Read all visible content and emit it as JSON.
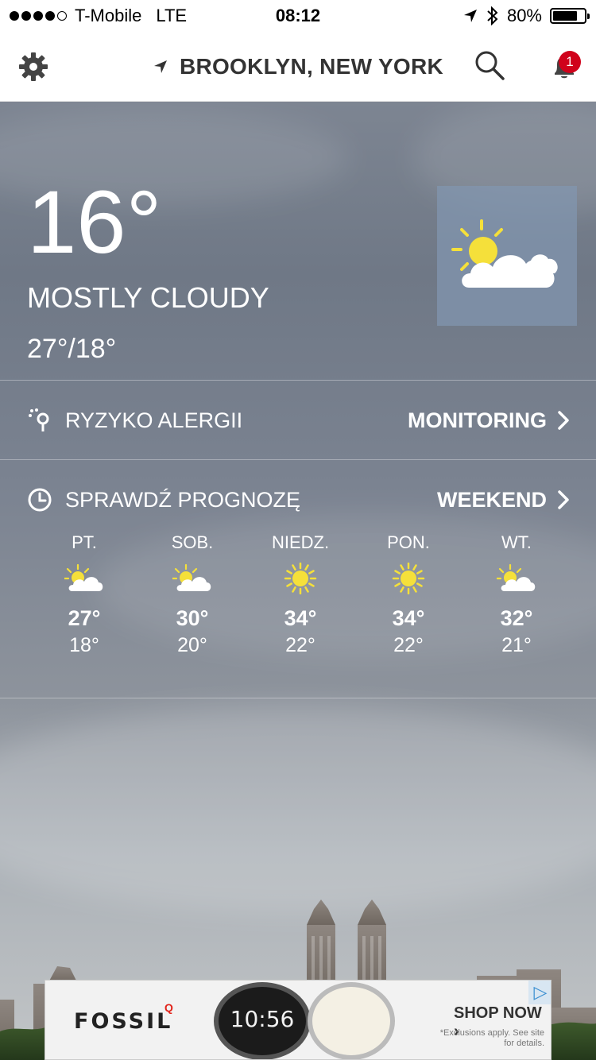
{
  "status_bar": {
    "carrier": "T-Mobile",
    "network": "LTE",
    "time": "08:12",
    "battery_percent": "80%",
    "battery_level": 0.8,
    "signal_bars_filled": 4,
    "signal_bars_total": 5
  },
  "header": {
    "location": "BROOKLYN, NEW YORK",
    "notification_count": "1",
    "icons": [
      "gear-icon",
      "location-arrow-icon",
      "search-icon",
      "bell-icon"
    ]
  },
  "current": {
    "temperature": "16°",
    "condition": "MOSTLY CLOUDY",
    "hi_lo": "27°/18°",
    "icon": "partly-cloudy-icon"
  },
  "allergy_row": {
    "label": "RYZYKO ALERGII",
    "action": "MONITORING",
    "icon": "allergy-icon"
  },
  "forecast_row": {
    "label": "SPRAWDŹ PROGNOZĘ",
    "action": "WEEKEND",
    "icon": "clock-icon"
  },
  "forecast": [
    {
      "day": "PT.",
      "high": "27°",
      "low": "18°",
      "icon": "partly-cloudy-icon"
    },
    {
      "day": "SOB.",
      "high": "30°",
      "low": "20°",
      "icon": "partly-cloudy-icon"
    },
    {
      "day": "NIEDZ.",
      "high": "34°",
      "low": "22°",
      "icon": "sunny-icon"
    },
    {
      "day": "PON.",
      "high": "34°",
      "low": "22°",
      "icon": "sunny-icon"
    },
    {
      "day": "WT.",
      "high": "32°",
      "low": "21°",
      "icon": "partly-cloudy-icon"
    }
  ],
  "ad": {
    "brand": "FOSSIL",
    "brand_mark": "Q",
    "watch_time": "10:56",
    "cta": "SHOP NOW ›",
    "disclaimer": "*Exclusions apply. See site for details.",
    "ad_choices_glyph": "▷"
  },
  "colors": {
    "badge": "#d0021b",
    "sun": "#f5e03a",
    "header_text": "#333333"
  }
}
